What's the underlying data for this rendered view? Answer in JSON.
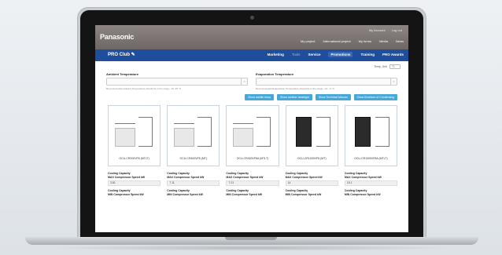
{
  "site": {
    "logo": "Panasonic",
    "util_links": [
      "My Account",
      "Log out"
    ],
    "top_nav": [
      "My project",
      "International project",
      "My forms",
      "Media",
      "News"
    ],
    "club_title": "PRO Club",
    "main_nav": [
      {
        "label": "Marketing",
        "state": "normal"
      },
      {
        "label": "Tools",
        "state": "dim"
      },
      {
        "label": "Service",
        "state": "normal"
      },
      {
        "label": "Promotions",
        "state": "active"
      },
      {
        "label": "Training",
        "state": "normal"
      },
      {
        "label": "PRO Awards",
        "state": "normal"
      }
    ]
  },
  "form": {
    "temp_unit_label": "Temp. Unit",
    "temp_unit_value": "°C",
    "ambient_label": "Ambient Temperature",
    "ambient_hint": "Recommended ambient Temperature should be in the range: -15..35 °C",
    "evap_label": "Evaporation Temperature",
    "evap_hint": "Recommended Evaporation Temperature should be in the range: -10..-5 °C",
    "clear_glyph": "×"
  },
  "buttons": [
    "Show middle temp",
    "Show another heatsight",
    "Show Technical Manual",
    "Show Brochure of Condensing"
  ],
  "cards": [
    {
      "model": "OCU-CR200VF8 (MTLT)",
      "cap_label": "Cooling Capacity\nMAX Compressor Speed kW",
      "value": "3.81",
      "cap_label2": "Cooling Capacity\nMIN Compressor Speed kW",
      "style": "light"
    },
    {
      "model": "OCU-CR400VF8 (MT)",
      "cap_label": "Cooling Capacity\nMAX Compressor Speed kW",
      "value": "7.11",
      "cap_label2": "Cooling Capacity\nMIN Compressor Speed kW",
      "style": "light"
    },
    {
      "model": "OCU-CR400VF8A (MTLT)",
      "cap_label": "Cooling Capacity\nMAX Compressor Speed kW",
      "value": "7.21",
      "cap_label2": "Cooling Capacity\nMIN Compressor Speed kW",
      "style": "light"
    },
    {
      "model": "OCU-CR1000VF8 (MT)",
      "cap_label": "Cooling Capacity\nMAX Compressor Speed kW",
      "value": "14",
      "cap_label2": "Cooling Capacity\nMIN Compressor Speed kW",
      "style": "dark"
    },
    {
      "model": "OCU-CR1000VF8A (MTLT)",
      "cap_label": "Cooling Capacity\nMAX Compressor Speed kW",
      "value": "15.1",
      "cap_label2": "Cooling Capacity\nMIN Compressor Speed kW",
      "style": "dark"
    }
  ],
  "colors": {
    "nav_blue": "#1f4f9c",
    "button_blue": "#44a9d9",
    "top_grey": "#7c7574"
  }
}
